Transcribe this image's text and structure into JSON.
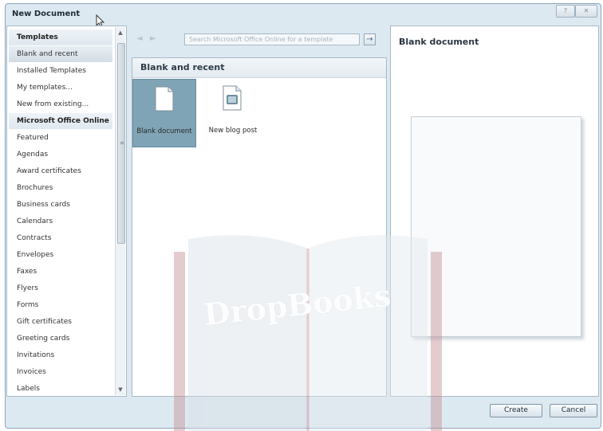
{
  "window": {
    "title": "New Document",
    "help_label": "?",
    "close_label": "✕"
  },
  "left_panel": {
    "items": [
      {
        "label": "Templates",
        "header": true
      },
      {
        "label": "Blank and recent",
        "selected": true
      },
      {
        "label": "Installed Templates"
      },
      {
        "label": "My templates..."
      },
      {
        "label": "New from existing..."
      },
      {
        "label": "Microsoft Office Online",
        "header": true
      },
      {
        "label": "Featured"
      },
      {
        "label": "Agendas"
      },
      {
        "label": "Award certificates"
      },
      {
        "label": "Brochures"
      },
      {
        "label": "Business cards"
      },
      {
        "label": "Calendars"
      },
      {
        "label": "Contracts"
      },
      {
        "label": "Envelopes"
      },
      {
        "label": "Faxes"
      },
      {
        "label": "Flyers"
      },
      {
        "label": "Forms"
      },
      {
        "label": "Gift certificates"
      },
      {
        "label": "Greeting cards"
      },
      {
        "label": "Invitations"
      },
      {
        "label": "Invoices"
      },
      {
        "label": "Labels"
      }
    ]
  },
  "nav": {
    "back": "◄",
    "forward": "►",
    "search_placeholder": "Search Microsoft Office Online for a template",
    "go": "→"
  },
  "middle": {
    "header": "Blank and recent",
    "tiles": [
      {
        "label": "Blank document",
        "icon": "blank-document-icon",
        "selected": true
      },
      {
        "label": "New blog post",
        "icon": "blog-post-icon",
        "selected": false
      }
    ]
  },
  "preview": {
    "title": "Blank document"
  },
  "buttons": {
    "create": "Create",
    "cancel": "Cancel"
  },
  "watermark": {
    "text": "DropBooks"
  },
  "colors": {
    "dialog_bg": "#dde9f1",
    "selected_tile": "#7fa4b6",
    "watermark_book": "#c58f95",
    "watermark_text": "#ffffff"
  }
}
